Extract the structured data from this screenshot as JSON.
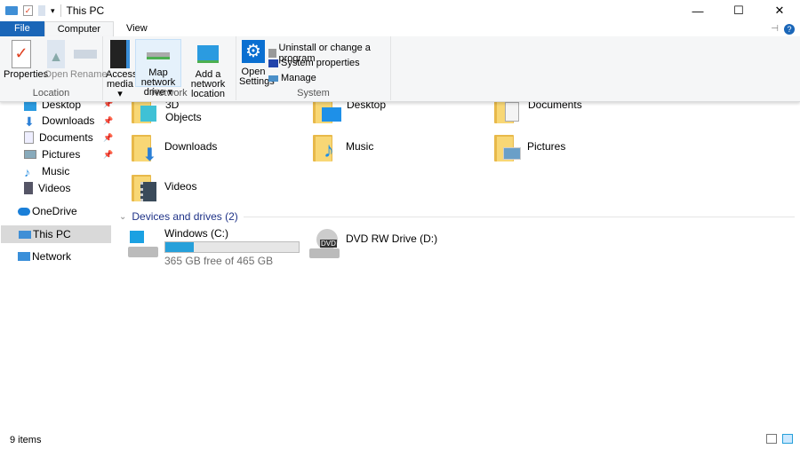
{
  "window": {
    "title": "This PC",
    "controls": {
      "minimize": "—",
      "maximize": "☐",
      "close": "✕"
    }
  },
  "tabs": [
    {
      "label": "File"
    },
    {
      "label": "Computer"
    },
    {
      "label": "View"
    }
  ],
  "ribbon": {
    "groups": {
      "location": {
        "label": "Location",
        "buttons": [
          "Properties",
          "Open",
          "Rename"
        ]
      },
      "network": {
        "label": "Network",
        "access_media": [
          "Access",
          "media ▾"
        ],
        "map_drive": [
          "Map network",
          "drive ▾"
        ],
        "add_location": [
          "Add a network",
          "location"
        ]
      },
      "system": {
        "label": "System",
        "open_settings": [
          "Open",
          "Settings"
        ],
        "small": [
          "Uninstall or change a program",
          "System properties",
          "Manage"
        ]
      }
    },
    "help": "?"
  },
  "sidebar": {
    "items": [
      {
        "label": "Desktop",
        "pinned": true
      },
      {
        "label": "Downloads",
        "pinned": true
      },
      {
        "label": "Documents",
        "pinned": true
      },
      {
        "label": "Pictures",
        "pinned": true
      },
      {
        "label": "Music"
      },
      {
        "label": "Videos"
      },
      {
        "label": "OneDrive"
      },
      {
        "label": "This PC",
        "selected": true
      },
      {
        "label": "Network"
      }
    ]
  },
  "folders": [
    "3D Objects",
    "Desktop",
    "Documents",
    "Downloads",
    "Music",
    "Pictures",
    "Videos"
  ],
  "devices": {
    "header": "Devices and drives (2)",
    "drives": [
      {
        "name": "Windows (C:)",
        "free": "365 GB free of 465 GB",
        "used_percent": 21.5
      },
      {
        "name": "DVD RW Drive (D:)"
      }
    ]
  },
  "status": {
    "count": "9 items"
  },
  "colors": {
    "accent": "#1a66b8",
    "drive_bar": "#26a0da",
    "folder": "#f8d775"
  }
}
